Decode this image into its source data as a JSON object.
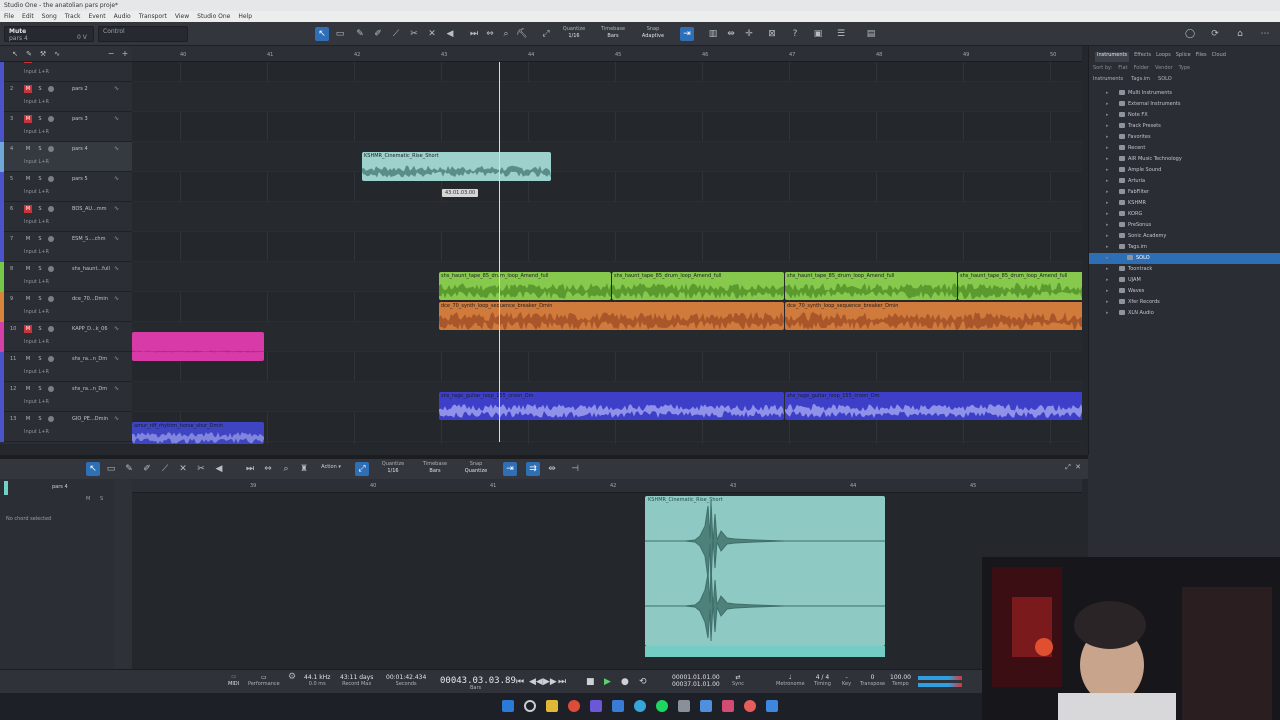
{
  "window": {
    "title": "Studio One - the anatolian pars proje*"
  },
  "menu": [
    "File",
    "Edit",
    "Song",
    "Track",
    "Event",
    "Audio",
    "Transport",
    "View",
    "Studio One",
    "Help"
  ],
  "toolbar": {
    "track_name": "Mute",
    "track_sub": "pars 4",
    "track_value": "0 V",
    "control_label": "Control",
    "quantize_label": "Quantize",
    "quantize_value": "1/16",
    "timebase_label": "Timebase",
    "timebase_value": "Bars",
    "snap_label": "Snap",
    "snap_value": "Adaptive"
  },
  "ruler": {
    "bars": [
      "40",
      "41",
      "42",
      "43",
      "44",
      "45",
      "46",
      "47",
      "48",
      "49",
      "50"
    ]
  },
  "tracks": [
    {
      "num": "1",
      "name": "pars 1",
      "input": "Input L+R",
      "color": "#4a53c9",
      "rec_red": true
    },
    {
      "num": "2",
      "name": "pars 2",
      "input": "Input L+R",
      "color": "#4a53c9",
      "rec_red": true
    },
    {
      "num": "3",
      "name": "pars 3",
      "input": "Input L+R",
      "color": "#4a53c9",
      "rec_red": true
    },
    {
      "num": "4",
      "name": "pars 4",
      "input": "Input L+R",
      "color": "#6fa8d8",
      "rec_red": false
    },
    {
      "num": "5",
      "name": "pars 5",
      "input": "Input L+R",
      "color": "#4a53c9",
      "rec_red": false
    },
    {
      "num": "6",
      "name": "BOS_AU...mm",
      "input": "Input L+R",
      "color": "#4a53c9",
      "rec_red": true
    },
    {
      "num": "7",
      "name": "ESM_S....chm",
      "input": "Input L+R",
      "color": "#4a53c9",
      "rec_red": false
    },
    {
      "num": "8",
      "name": "shs_haunt...full",
      "input": "Input L+R",
      "color": "#75c84a",
      "rec_red": false
    },
    {
      "num": "9",
      "name": "dce_70...Dmin",
      "input": "Input L+R",
      "color": "#d9843b",
      "rec_red": false
    },
    {
      "num": "10",
      "name": "KAPP_D...k_06",
      "input": "Input L+R",
      "color": "#d63ea8",
      "rec_red": true
    },
    {
      "num": "11",
      "name": "shs_ra...n_Dm",
      "input": "Input L+R",
      "color": "#4a53c9",
      "rec_red": false
    },
    {
      "num": "12",
      "name": "shs_ra...n_Dm",
      "input": "Input L+R",
      "color": "#4a53c9",
      "rec_red": false
    },
    {
      "num": "13",
      "name": "GIO_PE...Dmin",
      "input": "Input L+R",
      "color": "#4a53c9",
      "rec_red": false
    }
  ],
  "clips": {
    "pars4": "KSHMR_Cinematic_Rise_Short",
    "green": [
      "shs_haunt_tape_85_drum_loop_Amend_full",
      "shs_haunt_tape_85_drum_loop_Amend_full",
      "shs_haunt_tape_85_drum_loop_Amend_full",
      "shs_haunt_tape_85_drum_loop_Amend_full"
    ],
    "orange": [
      "dce_70_synth_loop_sequence_breaker_Dmin",
      "dce_70_synth_loop_sequence_breaker_Dmin"
    ],
    "blue": [
      "shs_rage_guitar_loop_155_croon_Dm",
      "shs_rage_guitar_loop_155_croon_Dm"
    ],
    "riff": "amur_riff_rhythm_horse_shur_Dmin",
    "tooltip": "43.01.03.00"
  },
  "browser": {
    "tabs": [
      "Instruments",
      "Effects",
      "Loops",
      "Splice",
      "Files",
      "Cloud"
    ],
    "filter": [
      "Sort by:",
      "Flat",
      "Folder",
      "Vendor",
      "Type"
    ],
    "crumb": [
      "Instruments",
      "Tags.im",
      "SOLO"
    ],
    "items": [
      "Multi Instruments",
      "External Instruments",
      "Note FX",
      "Track Presets",
      "Favorites",
      "Recent",
      "AIR Music Technology",
      "Ample Sound",
      "Arturia",
      "FabFilter",
      "KSHMR",
      "KORG",
      "PreSonus",
      "Sonic Academy",
      "Tags.im",
      "SOLO",
      "Toontrack",
      "UJAM",
      "Waves",
      "Xfer Records",
      "XLN Audio"
    ],
    "selected": "SOLO"
  },
  "editor": {
    "track": "pars 4",
    "chord": "No chord selected",
    "action": "Action",
    "quantize_label": "Quantize",
    "quantize_value": "1/16",
    "timebase_label": "Timebase",
    "timebase_value": "Bars",
    "snap_label": "Snap",
    "snap_value": "Quantize",
    "clip": "KSHMR_Cinematic_Rise_Short",
    "ruler": [
      "39",
      "40",
      "41",
      "42",
      "43",
      "44",
      "45"
    ]
  },
  "transport": {
    "sample_rate": "44.1 kHz",
    "latency": "0.0 ms",
    "performance": "Performance",
    "record_days": "43:11 days",
    "record_label": "Record Max",
    "seconds": "00:01:42.434",
    "seconds_label": "Seconds",
    "bars": "00043.03.03.89",
    "bars_label": "Bars",
    "loop_start": "00001.01.01.00",
    "loop_end": "00037.01.01.00",
    "sync": "Sync",
    "metronome": "Metronome",
    "timesig": "4 / 4",
    "timing": "Timing",
    "key": "Key",
    "transpose_value": "0",
    "transpose": "Transpose",
    "tempo_value": "100.00",
    "tempo": "Tempo"
  }
}
